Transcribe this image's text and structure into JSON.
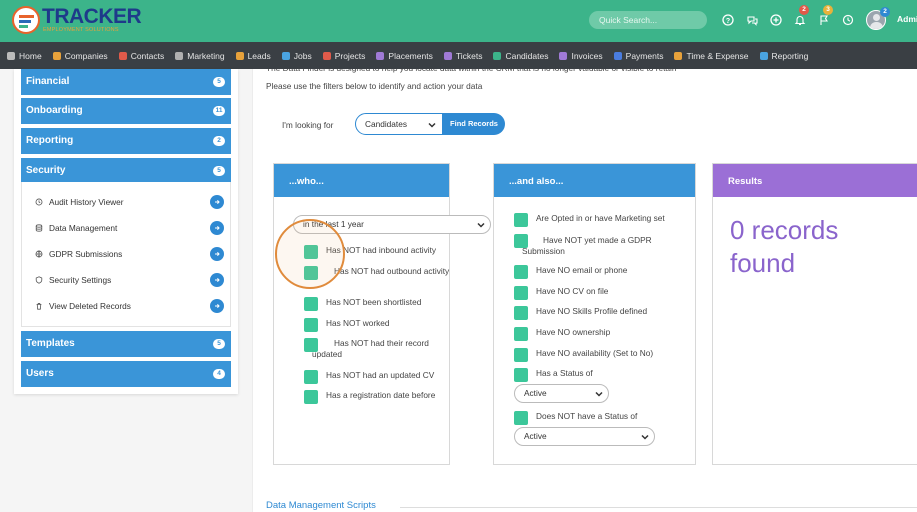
{
  "brand": {
    "name": "TRACKER",
    "tagline": "EMPLOYMENT SOLUTIONS"
  },
  "topbar": {
    "search_placeholder": "Quick Search...",
    "badges": {
      "notifications": "2",
      "flags": "3",
      "messages": "2"
    },
    "user_label": "Admi"
  },
  "nav": [
    {
      "label": "Home",
      "icon": "home-icon",
      "color": "#bbbbbb"
    },
    {
      "label": "Companies",
      "icon": "building-icon",
      "color": "#e8a23b"
    },
    {
      "label": "Contacts",
      "icon": "contact-card-icon",
      "color": "#e05a4a"
    },
    {
      "label": "Marketing",
      "icon": "megaphone-icon",
      "color": "#b0b0b0"
    },
    {
      "label": "Leads",
      "icon": "tag-icon",
      "color": "#e8a23b"
    },
    {
      "label": "Jobs",
      "icon": "funnel-icon",
      "color": "#4aa3e0"
    },
    {
      "label": "Projects",
      "icon": "clipboard-icon",
      "color": "#e05a4a"
    },
    {
      "label": "Placements",
      "icon": "briefcase-icon",
      "color": "#a07ad6"
    },
    {
      "label": "Tickets",
      "icon": "ticket-icon",
      "color": "#a07ad6"
    },
    {
      "label": "Candidates",
      "icon": "users-icon",
      "color": "#3cb48a"
    },
    {
      "label": "Invoices",
      "icon": "invoice-icon",
      "color": "#a07ad6"
    },
    {
      "label": "Payments",
      "icon": "coins-icon",
      "color": "#4a7de0"
    },
    {
      "label": "Time & Expense",
      "icon": "clock-icon",
      "color": "#e8a23b"
    },
    {
      "label": "Reporting",
      "icon": "chart-icon",
      "color": "#4aa3e0"
    }
  ],
  "sidebar": {
    "groups": [
      {
        "label": "Financial",
        "count": "5"
      },
      {
        "label": "Onboarding",
        "count": "11"
      },
      {
        "label": "Reporting",
        "count": "2"
      },
      {
        "label": "Security",
        "count": "5"
      },
      {
        "label": "Templates",
        "count": "5"
      },
      {
        "label": "Users",
        "count": "4"
      }
    ],
    "security_items": [
      {
        "label": "Audit History Viewer",
        "icon": "history-icon"
      },
      {
        "label": "Data Management",
        "icon": "database-icon"
      },
      {
        "label": "GDPR Submissions",
        "icon": "globe-icon"
      },
      {
        "label": "Security Settings",
        "icon": "shield-icon"
      },
      {
        "label": "View Deleted Records",
        "icon": "trash-icon"
      }
    ]
  },
  "main": {
    "intro_line1": "The Data Finder is designed to help you locate data within the CRM that is no longer valuable or visible to retain",
    "intro_line2": "Please use the filters below to identify and action your data",
    "looking_for_label": "I'm looking for",
    "looking_for_value": "Candidates",
    "find_button": "Find Records",
    "who": {
      "title": "...who...",
      "period_value": "in the last 1 year",
      "items": [
        "Has NOT had inbound activity",
        "Has NOT had outbound activity",
        "Has NOT been shortlisted",
        "Has NOT worked",
        "Has NOT had their record updated",
        "Has NOT had an updated CV",
        "Has a registration date before"
      ]
    },
    "also": {
      "title": "...and also...",
      "items": [
        "Are Opted in or have Marketing set",
        "Have NOT yet made a GDPR Submission",
        "Have NO email or phone",
        "Have NO CV on file",
        "Have NO Skills Profile defined",
        "Have NO ownership",
        "Have NO availability (Set to No)",
        "Has a Status of",
        "Does NOT have a Status of"
      ],
      "status_value": "Active",
      "not_status_value": "Active"
    },
    "results": {
      "title": "Results",
      "value": "0 records found"
    },
    "scripts_link": "Data Management Scripts"
  },
  "colors": {
    "topbar": "#3cb48a",
    "navbar": "#3a3f44",
    "panel_blue": "#3a95d8",
    "results_purple": "#9b6fd6",
    "checkbox_green": "#3cc79a"
  }
}
